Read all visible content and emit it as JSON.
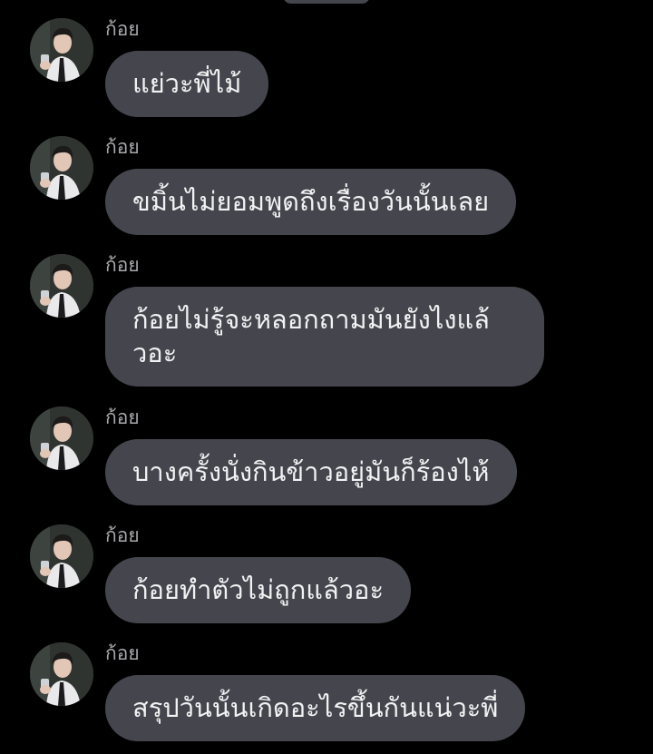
{
  "chat": {
    "messages": [
      {
        "sender": "ก้อย",
        "avatar_icon": "profile-photo",
        "text": "แย่วะพี่ไม้"
      },
      {
        "sender": "ก้อย",
        "avatar_icon": "profile-photo",
        "text": "ขมิ้นไม่ยอมพูดถึงเรื่องวันนั้นเลย"
      },
      {
        "sender": "ก้อย",
        "avatar_icon": "profile-photo",
        "text": "ก้อยไม่รู้จะหลอกถามมันยังไงแล้วอะ"
      },
      {
        "sender": "ก้อย",
        "avatar_icon": "profile-photo",
        "text": "บางครั้งนั่งกินข้าวอยู่มันก็ร้องไห้"
      },
      {
        "sender": "ก้อย",
        "avatar_icon": "profile-photo",
        "text": "ก้อยทำตัวไม่ถูกแล้วอะ"
      },
      {
        "sender": "ก้อย",
        "avatar_icon": "profile-photo",
        "text": "สรุปวันนั้นเกิดอะไรขึ้นกันแน่วะพี่"
      }
    ]
  },
  "colors": {
    "background": "#000000",
    "bubble": "#45464d",
    "bubble_text": "#f2f2f4",
    "sender_text": "#a9a9ad"
  }
}
